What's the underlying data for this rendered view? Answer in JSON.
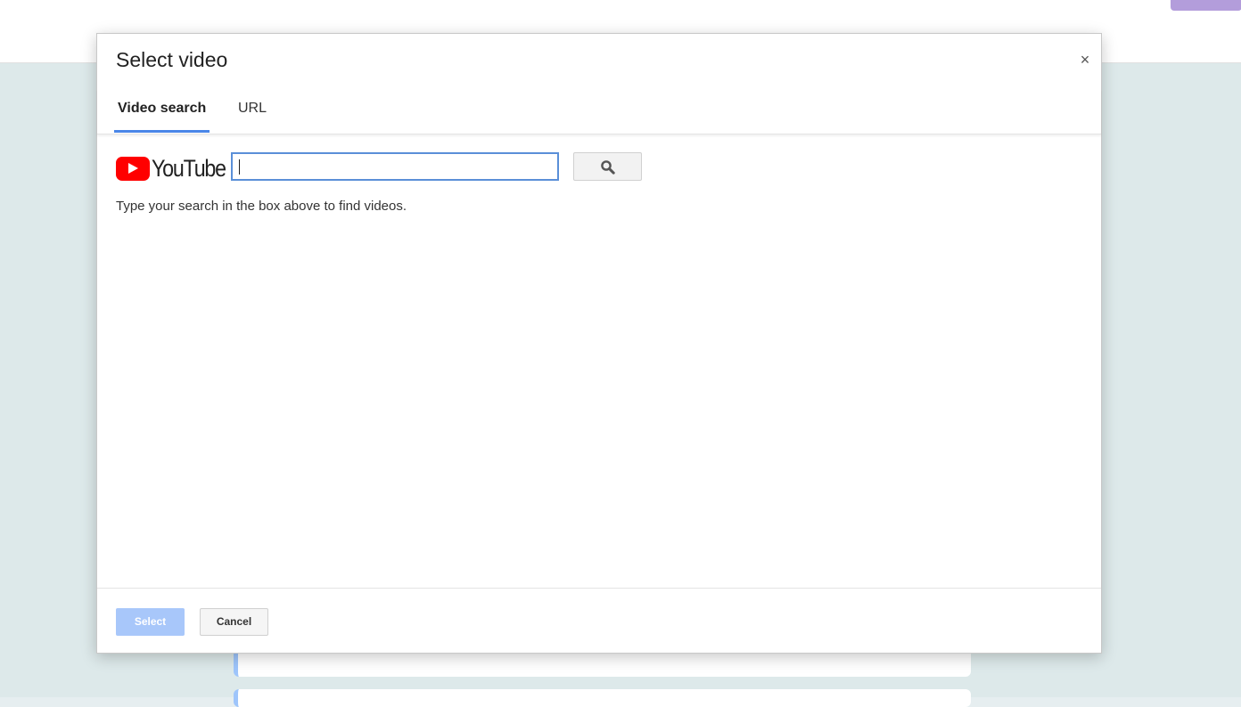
{
  "background": {
    "partial_logo": "",
    "accent_color": "#b39ddb"
  },
  "dialog": {
    "title": "Select video",
    "close_label": "×",
    "tabs": [
      {
        "label": "Video search",
        "active": true
      },
      {
        "label": "URL",
        "active": false
      }
    ],
    "search": {
      "provider_label": "YouTube",
      "value": "",
      "placeholder": "",
      "button_icon": "search-icon"
    },
    "hint": "Type your search in the box above to find videos.",
    "footer": {
      "select_label": "Select",
      "cancel_label": "Cancel",
      "select_enabled": false
    },
    "colors": {
      "accent": "#4a86e8",
      "select_button": "#a8c7fa",
      "youtube_red": "#ff0000"
    }
  }
}
